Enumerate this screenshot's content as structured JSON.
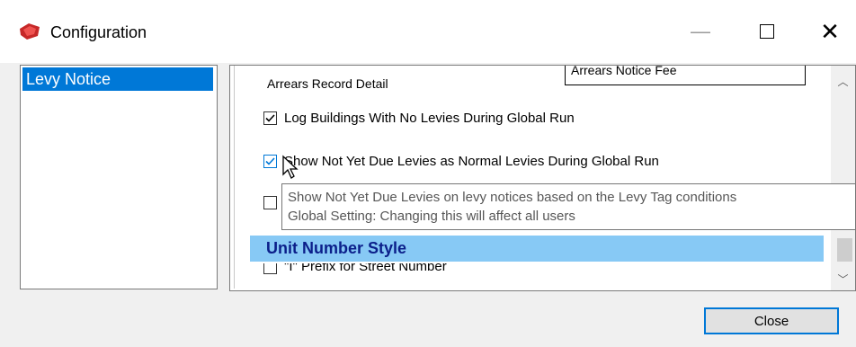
{
  "window": {
    "title": "Configuration",
    "min_glyph": "—",
    "close_glyph": "✕"
  },
  "left_panel": {
    "items": [
      {
        "label": "Levy Notice",
        "selected": true
      }
    ]
  },
  "right_panel": {
    "arrears_label": "Arrears Record Detail",
    "arrears_fee_field_text": "Arrears Notice Fee",
    "checkboxes": [
      {
        "label": "Log Buildings With No Levies During Global Run",
        "checked": true
      },
      {
        "label": "Show Not Yet Due Levies as Normal Levies During Global Run",
        "checked": true
      },
      {
        "label": "",
        "checked": false
      }
    ],
    "section_header": "Unit Number Style",
    "partial_row_label": "\"I\" Prefix for Street Number"
  },
  "tooltip": {
    "line1": "Show Not Yet Due Levies on levy notices based on the Levy Tag conditions",
    "line2": "Global Setting: Changing this will affect all users"
  },
  "footer": {
    "close_label": "Close"
  },
  "scrollbar": {
    "up_glyph": "︿",
    "down_glyph": "﹀"
  },
  "colors": {
    "accent": "#0078d7",
    "section_header_bg": "#87c9f5",
    "section_header_text": "#0b1f8a"
  }
}
